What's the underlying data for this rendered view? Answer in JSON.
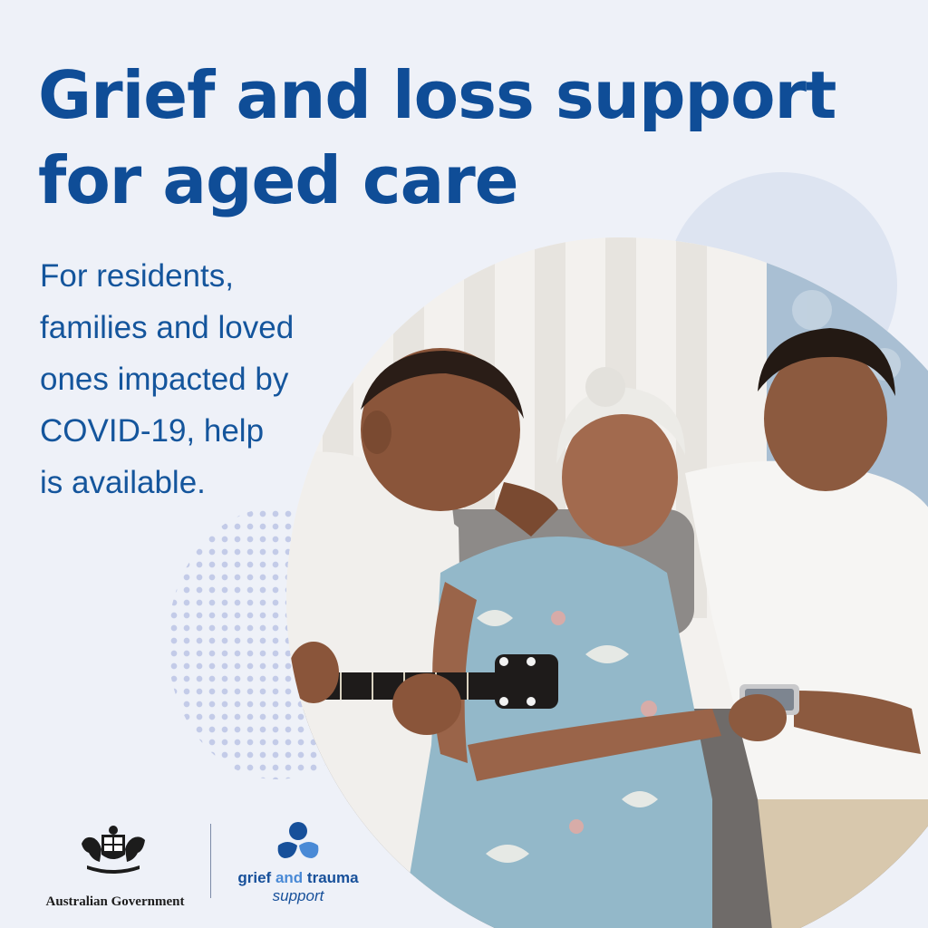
{
  "headline": {
    "line1": "Grief and loss support",
    "line2": "for aged care"
  },
  "intro": {
    "line1": "For residents,",
    "line2": "families and loved",
    "line3": "ones impacted by",
    "line4": "COVID-19, help",
    "line5": "is available."
  },
  "footer": {
    "government_logo_name": "Australian Government",
    "service_logo": {
      "word_grief": "grief",
      "word_and": "and",
      "word_trauma": "trauma",
      "word_support": "support"
    }
  },
  "colors": {
    "background": "#eef1f8",
    "headline": "#0f4d97",
    "body_text": "#14559c",
    "logo_blue": "#17509a",
    "logo_light_blue": "#4a8ad6"
  },
  "icons": [
    "coat-of-arms-icon",
    "grief-trauma-flower-icon"
  ]
}
